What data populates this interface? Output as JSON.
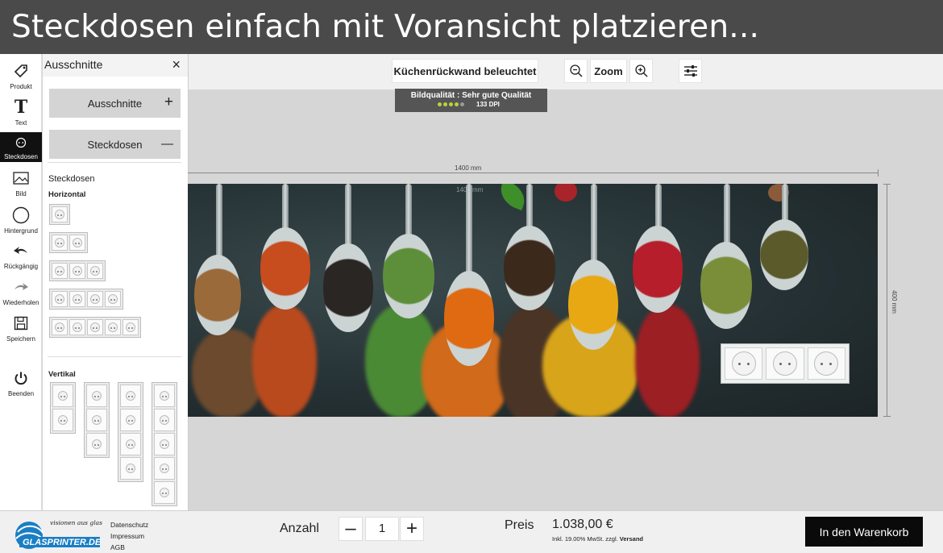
{
  "banner": {
    "title": "Steckdosen einfach mit Voransicht platzieren..."
  },
  "toolrail": {
    "items": [
      {
        "label": "Produkt",
        "icon": "tag-icon"
      },
      {
        "label": "Text",
        "icon": "text-icon"
      },
      {
        "label": "Steckdosen",
        "icon": "socket-icon",
        "active": true
      },
      {
        "label": "Bild",
        "icon": "image-icon"
      },
      {
        "label": "Hintergrund",
        "icon": "circle-icon"
      },
      {
        "label": "Rückgängig",
        "icon": "undo-icon"
      },
      {
        "label": "Wiederholen",
        "icon": "redo-icon"
      },
      {
        "label": "Speichern",
        "icon": "save-icon"
      },
      {
        "label": "Beenden",
        "icon": "power-icon"
      }
    ]
  },
  "panel": {
    "title": "Ausschnitte",
    "accordion": [
      {
        "label": "Ausschnitte",
        "sign": "+"
      },
      {
        "label": "Steckdosen",
        "sign": "—"
      }
    ],
    "section_title": "Steckdosen",
    "horizontal_label": "Horizontal",
    "vertical_label": "Vertikal",
    "horizontal_counts": [
      1,
      2,
      3,
      4,
      5
    ],
    "vertical_counts": [
      2,
      3,
      4,
      5
    ]
  },
  "topbar": {
    "product_label": "Küchenrückwand beleuchtet",
    "zoom_label": "Zoom"
  },
  "quality": {
    "label": "Bildqualität : Sehr gute Qualität",
    "dpi": "133 DPI",
    "level": 4,
    "max": 5
  },
  "dimensions": {
    "width": "1400 mm",
    "height": "400 mm",
    "watermark": "1400 mm"
  },
  "footer": {
    "logo_tagline": "visionen aus glas",
    "logo_name": "GLASPRINTER.DE",
    "links": [
      "Datenschutz",
      "Impressum",
      "AGB"
    ],
    "quantity_label": "Anzahl",
    "quantity": "1",
    "price_label": "Preis",
    "price": "1.038,00 €",
    "tax_note": "Inkl. 19.00% MwSt. zzgl.",
    "shipping_link": "Versand",
    "cart_button": "In den Warenkorb"
  },
  "colors": {
    "banner": "#4a4a4a",
    "active_tool": "#111111",
    "quality_dot_on": "#b8d43a",
    "cart_button": "#0a0a0a"
  }
}
